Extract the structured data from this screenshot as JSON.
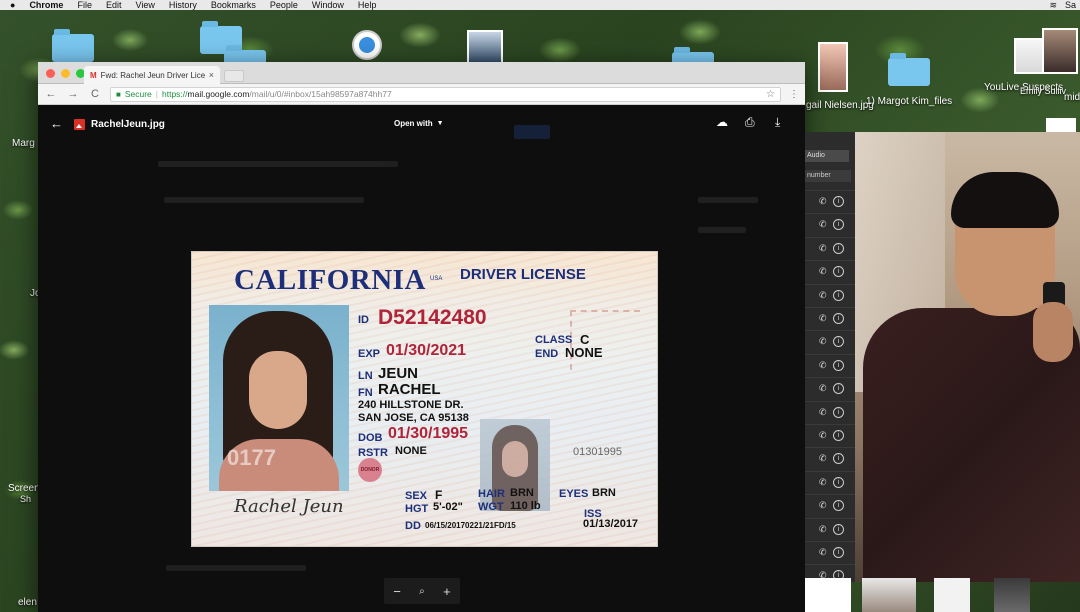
{
  "menubar": {
    "apple": "",
    "app_name": "Chrome",
    "items": [
      "File",
      "Edit",
      "View",
      "History",
      "Bookmarks",
      "People",
      "Window",
      "Help"
    ],
    "right_text": "Sa"
  },
  "desktop": {
    "labels": {
      "margot_left": "Marg",
      "abigail": "gail Nielsen.jpg",
      "margot_kim_files": "1) Margot Kim_files",
      "youlive": "YouLive Suspects",
      "emily": "Emily Sulliv",
      "mid": "mid",
      "screen": "Screen",
      "screen2": "Sh",
      "elen": "elen",
      "jo": "Jo"
    }
  },
  "browser": {
    "tab": {
      "favicon": "M",
      "title": "Fwd: Rachel Jeun Driver Licence",
      "close": "×"
    },
    "toolbar": {
      "back": "←",
      "forward": "→",
      "reload": "C",
      "secure_label": "Secure",
      "url_scheme": "https://",
      "url_host": "mail.google.com",
      "url_path": "/mail/u/0/#inbox/15ah98597a874hh77",
      "star": "☆",
      "menu": "⋮"
    }
  },
  "viewer": {
    "back_icon": "←",
    "file_name": "RachelJeun.jpg",
    "open_with": "Open with",
    "open_with_caret": "▼",
    "zoom": {
      "out": "−",
      "fit": "🔍",
      "in": "+"
    }
  },
  "license": {
    "state": "CALIFORNIA",
    "usa": "USA",
    "type": "DRIVER LICENSE",
    "id_label": "ID",
    "id": "D52142480",
    "exp_label": "EXP",
    "exp": "01/30/2021",
    "class_label": "CLASS",
    "class": "C",
    "end_label": "END",
    "end": "NONE",
    "ln_label": "LN",
    "ln": "JEUN",
    "fn_label": "FN",
    "fn": "RACHEL",
    "address1": "240 HILLSTONE DR.",
    "address2": "SAN JOSE, CA 95138",
    "dob_label": "DOB",
    "dob": "01/30/1995",
    "rstr_label": "RSTR",
    "rstr": "NONE",
    "side_number": "01301995",
    "photo_ghost": "0177",
    "donor": "DONOR",
    "sex_label": "SEX",
    "sex": "F",
    "hgt_label": "HGT",
    "hgt": "5'-02\"",
    "hair_label": "HAIR",
    "hair": "BRN",
    "wgt_label": "WGT",
    "wgt": "110 lb",
    "eyes_label": "EYES",
    "eyes": "BRN",
    "dd_label": "DD",
    "dd": "06/15/20170221/21FD/15",
    "iss_label": "ISS",
    "iss": "01/13/2017",
    "signature": "Rachel Jeun"
  },
  "sidepanel": {
    "header": "Audio",
    "sub": "number",
    "rows": 17,
    "phone_icon": "✆",
    "info_icon": "i"
  }
}
